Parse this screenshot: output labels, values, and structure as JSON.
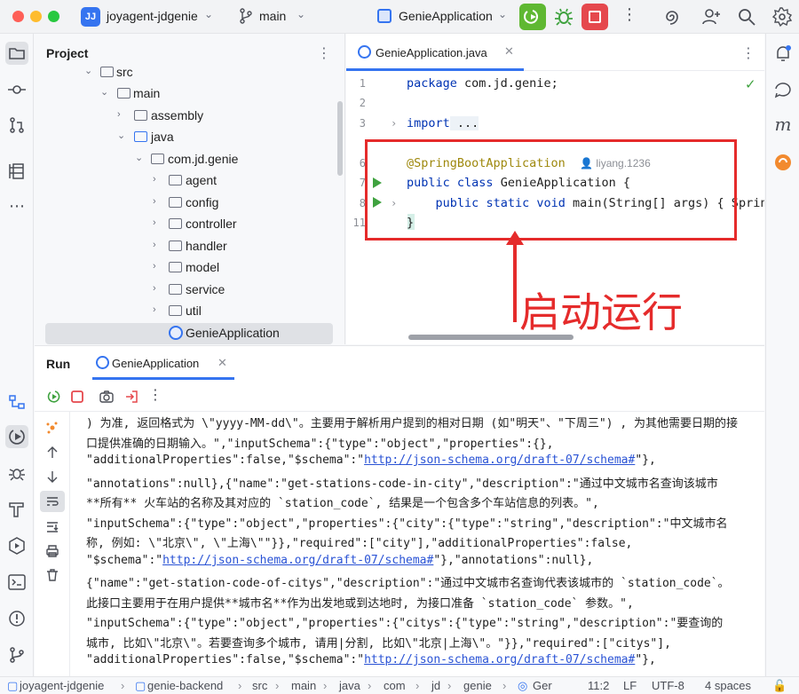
{
  "title_bar": {
    "project_badge": "JJ",
    "project_name": "joyagent-jdgenie",
    "branch": "main",
    "run_config": "GenieApplication"
  },
  "project_panel": {
    "title": "Project",
    "items": [
      {
        "label": "src"
      },
      {
        "label": "main"
      },
      {
        "label": "assembly"
      },
      {
        "label": "java"
      },
      {
        "label": "com.jd.genie"
      },
      {
        "label": "agent"
      },
      {
        "label": "config"
      },
      {
        "label": "controller"
      },
      {
        "label": "handler"
      },
      {
        "label": "model"
      },
      {
        "label": "service"
      },
      {
        "label": "util"
      },
      {
        "label": "GenieApplication"
      }
    ]
  },
  "editor": {
    "tab_label": "GenieApplication.java",
    "line_numbers": [
      "1",
      "2",
      "3",
      "6",
      "7",
      "8",
      "11"
    ],
    "code": {
      "line1_kw": "package",
      "line1_rest": " com.jd.genie;",
      "line3_kw": "import",
      "line3_rest": " ...",
      "line6_annotation": "@SpringBootApplication",
      "line6_author": "liyang.1236",
      "line7_kw1": "public",
      "line7_kw2": "class",
      "line7_rest": " GenieApplication {",
      "line8_kw1": "public",
      "line8_kw2": "static",
      "line8_kw3": "void",
      "line8_rest": " main(String[] args) { Spring",
      "line11": "}"
    },
    "annotation_text": "启动运行"
  },
  "run_panel": {
    "title": "Run",
    "tab_label": "GenieApplication",
    "console_lines": [
      ") 为准, 返回格式为 \\\"yyyy-MM-dd\\\"。主要用于解析用户提到的相对日期 (如\"明天\"、\"下周三\") , 为其他需要日期的接",
      "口提供准确的日期输入。\",\"inputSchema\":{\"type\":\"object\",\"properties\":{},",
      "\"additionalProperties\":false,\"$schema\":\"",
      "\"annotations\":null},{\"name\":\"get-stations-code-in-city\",\"description\":\"通过中文城市名查询该城市",
      "**所有** 火车站的名称及其对应的 `station_code`, 结果是一个包含多个车站信息的列表。\",",
      "\"inputSchema\":{\"type\":\"object\",\"properties\":{\"city\":{\"type\":\"string\",\"description\":\"中文城市名",
      "称, 例如: \\\"北京\\\", \\\"上海\\\"\"}},\"required\":[\"city\"],\"additionalProperties\":false,",
      "\"$schema\":\"",
      "{\"name\":\"get-station-code-of-citys\",\"description\":\"通过中文城市名查询代表该城市的 `station_code`。",
      "此接口主要用于在用户提供**城市名**作为出发地或到达地时, 为接口准备 `station_code` 参数。\",",
      "\"inputSchema\":{\"type\":\"object\",\"properties\":{\"citys\":{\"type\":\"string\",\"description\":\"要查询的",
      "城市, 比如\\\"北京\\\"。若要查询多个城市, 请用|分割, 比如\\\"北京|上海\\\"。\"}},\"required\":[\"citys\"],",
      "\"additionalProperties\":false,\"$schema\":\""
    ],
    "link": "http://json-schema.org/draft-07/schema#",
    "line3_tail": "\"},",
    "line8_tail": "\"},\"annotations\":null},",
    "line13_tail": "\"},"
  },
  "status_bar": {
    "breadcrumbs": [
      "joyagent-jdgenie",
      "genie-backend",
      "src",
      "main",
      "java",
      "com",
      "jd",
      "genie",
      "Ger"
    ],
    "position": "11:2",
    "line_sep": "LF",
    "encoding": "UTF-8",
    "indent": "4 spaces"
  },
  "colors": {
    "accent": "#3574f0",
    "run_green": "#5fb832",
    "stop_red": "#e5484d",
    "annotation_red": "#e52b2b"
  }
}
